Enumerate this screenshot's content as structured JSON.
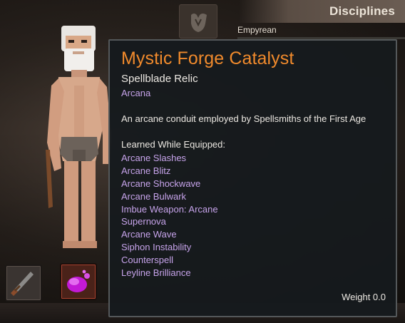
{
  "disciplines": {
    "title": "Disciplines",
    "subtitle": "Empyrean"
  },
  "inventory": {
    "slots": [
      {
        "icon": "dagger-icon"
      },
      {
        "icon": "purple-slime-catalyst-icon"
      }
    ]
  },
  "tooltip": {
    "item_name": "Mystic Forge Catalyst",
    "item_type": "Spellblade Relic",
    "category": "Arcana",
    "description": "An arcane conduit employed by Spellsmiths of the First Age",
    "learned_header": "Learned While Equipped:",
    "skills": [
      "Arcane Slashes",
      "Arcane Blitz",
      "Arcane Shockwave",
      "Arcane Bulwark",
      "Imbue Weapon: Arcane",
      "Supernova",
      "Arcane Wave",
      "Siphon Instability",
      "Counterspell",
      "Leyline Brilliance"
    ],
    "weight": "Weight 0.0"
  },
  "colors": {
    "title_orange": "#f08a2c",
    "skill_purple": "#c6a3ea",
    "panel_bg": "#161a1d"
  }
}
